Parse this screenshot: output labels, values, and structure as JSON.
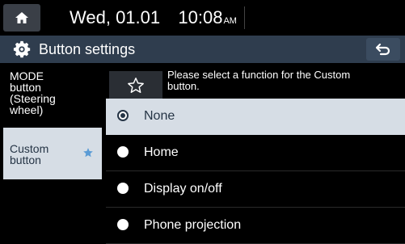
{
  "status": {
    "date": "Wed, 01.01",
    "time": "10:08",
    "ampm": "AM"
  },
  "header": {
    "title": "Button settings"
  },
  "sidebar": {
    "items": [
      {
        "label_lines": [
          "MODE",
          "button",
          "(Steering",
          "wheel)"
        ]
      },
      {
        "label_lines": [
          "Custom",
          "button"
        ]
      }
    ]
  },
  "main": {
    "instruction_lines": [
      "Please select a function for the Custom",
      "button."
    ],
    "options": [
      {
        "label": "None",
        "selected": true
      },
      {
        "label": "Home",
        "selected": false
      },
      {
        "label": "Display on/off",
        "selected": false
      },
      {
        "label": "Phone projection",
        "selected": false
      }
    ]
  },
  "colors": {
    "header_bg": "#2f3d4e",
    "selected_bg": "#d6dde5",
    "accent_star": "#5b9bd5"
  }
}
